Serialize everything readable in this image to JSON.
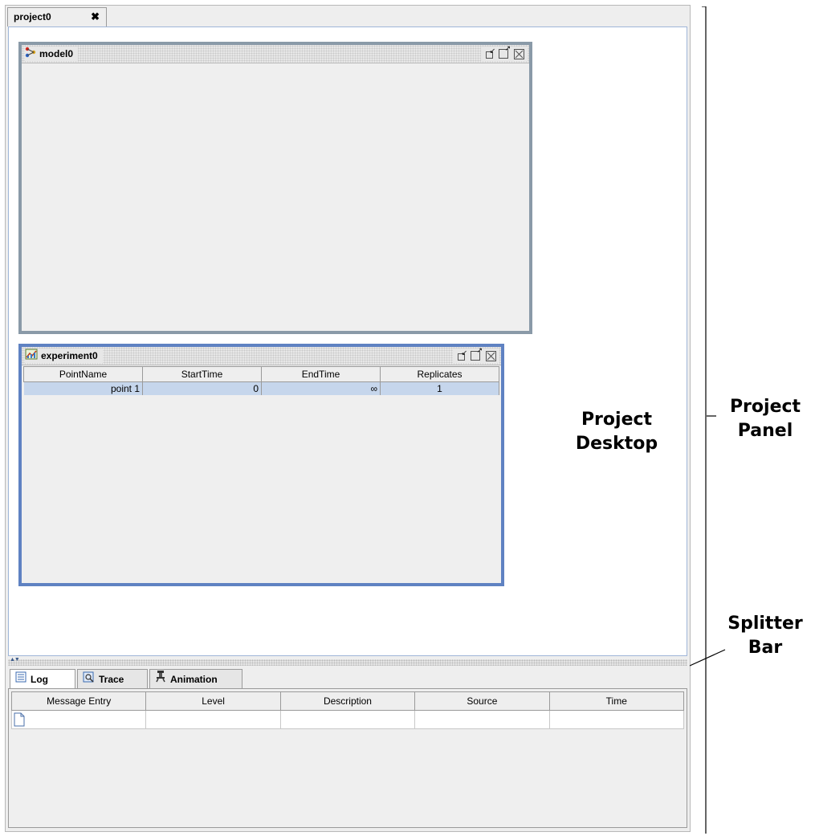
{
  "project": {
    "tab_label": "project0",
    "tab_close_glyph": "✖"
  },
  "model_window": {
    "title": "model0",
    "icon": "model-icon"
  },
  "experiment_window": {
    "title": "experiment0",
    "icon": "experiment-icon",
    "columns": [
      "PointName",
      "StartTime",
      "EndTime",
      "Replicates"
    ],
    "rows": [
      {
        "point_name": "point 1",
        "start_time": "0",
        "end_time": "∞",
        "replicates": "1"
      }
    ]
  },
  "bottom_tabs": [
    {
      "label": "Log",
      "icon": "log-icon"
    },
    {
      "label": "Trace",
      "icon": "trace-icon"
    },
    {
      "label": "Animation",
      "icon": "animation-icon"
    }
  ],
  "log_table": {
    "columns": [
      "Message Entry",
      "Level",
      "Description",
      "Source",
      "Time"
    ]
  },
  "annotations": {
    "project_desktop": [
      "Project",
      "Desktop"
    ],
    "project_panel": [
      "Project",
      "Panel"
    ],
    "splitter_bar": [
      "Splitter",
      "Bar"
    ]
  },
  "colors": {
    "selected_row": "#c6d6ec",
    "active_frame_border": "#5f82c2",
    "inactive_frame_border": "#8a9aa8",
    "desktop_background": "#ffffff"
  }
}
